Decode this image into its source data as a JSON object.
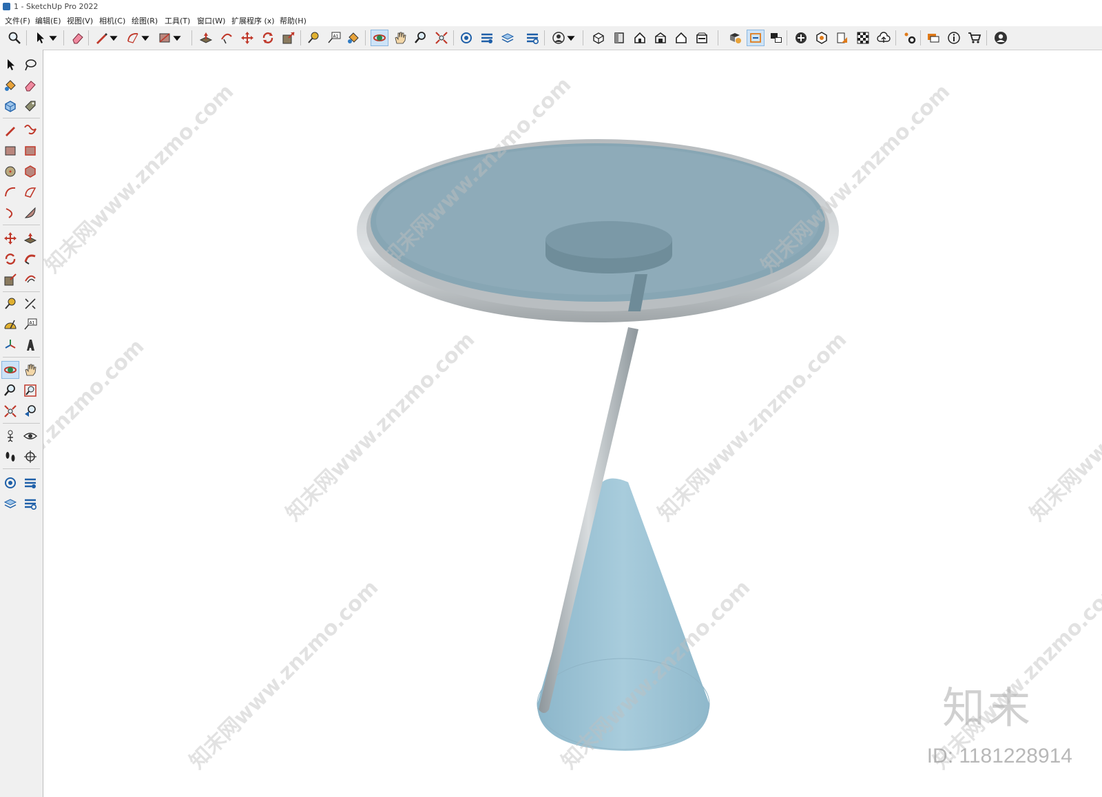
{
  "window": {
    "title": "1 - SketchUp Pro 2022"
  },
  "menu": {
    "items": [
      {
        "label": "文件(F)"
      },
      {
        "label": "编辑(E)"
      },
      {
        "label": "视图(V)"
      },
      {
        "label": "相机(C)"
      },
      {
        "label": "绘图(R)"
      },
      {
        "label": "工具(T)"
      },
      {
        "label": "窗口(W)"
      },
      {
        "label": "扩展程序 (x)"
      },
      {
        "label": "帮助(H)"
      }
    ]
  },
  "colors": {
    "glass_top": "#87a6b4",
    "rim": "#c9cdd0",
    "cone": "#9ec6d8",
    "rod": "#a9b0b4",
    "active_tool": "#cde3f7"
  },
  "watermark": {
    "text": "知末网www.znzmo.com"
  },
  "brand": {
    "logo": "知末",
    "id": "ID: 1181228914"
  }
}
